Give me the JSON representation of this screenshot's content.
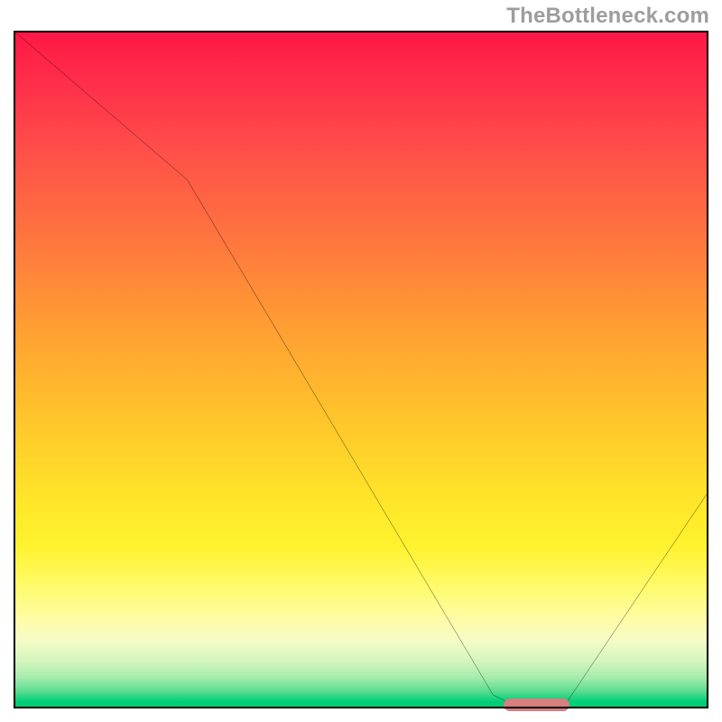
{
  "watermark": "TheBottleneck.com",
  "chart_data": {
    "type": "line",
    "title": "",
    "xlabel": "",
    "ylabel": "",
    "xlim": [
      0,
      100
    ],
    "ylim": [
      0,
      100
    ],
    "grid": false,
    "legend": false,
    "background_gradient": {
      "top_color": "#ff1744",
      "bottom_color": "#00c96f",
      "description": "vertical red-to-green gradient (through orange/yellow), indicating worse at top to best at bottom"
    },
    "series": [
      {
        "name": "bottleneck-curve",
        "x": [
          0,
          25,
          69,
          73,
          79,
          100
        ],
        "y": [
          100,
          78,
          2,
          0,
          0,
          32
        ],
        "stroke": "#000000",
        "stroke_width": 2
      }
    ],
    "annotations": [
      {
        "name": "optimal-range-marker",
        "type": "hbar",
        "x_start": 70.5,
        "x_end": 80,
        "y": 0.5,
        "color": "#d77e7e"
      }
    ]
  }
}
